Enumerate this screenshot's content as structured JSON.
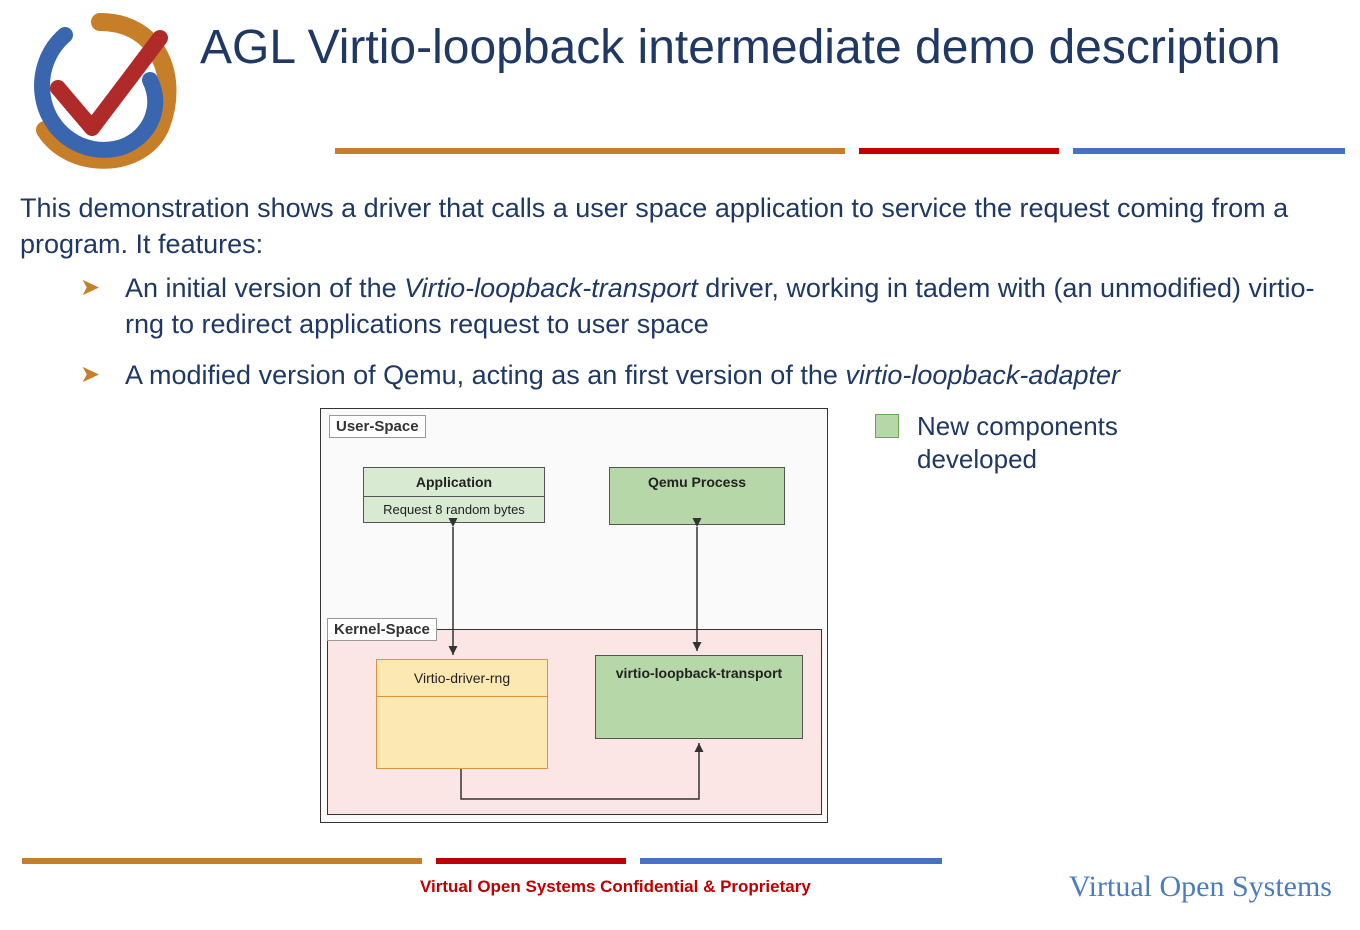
{
  "title": "AGL Virtio-loopback intermediate demo description",
  "intro": "This demonstration shows a driver that calls a user space application to service the request coming from a program. It features:",
  "bullets": {
    "b1_pre": "An initial version of the ",
    "b1_ital": "Virtio-loopback-transport",
    "b1_post": " driver, working in tadem with (an unmodified) virtio-rng to redirect applications request to user space",
    "b2_pre": "A modified version of Qemu, acting as an first version of the ",
    "b2_ital": "virtio-loopback-adapter"
  },
  "legend": "New components developed",
  "diagram": {
    "user_space": "User-Space",
    "kernel_space": "Kernel-Space",
    "application": "Application",
    "application_sub": "Request 8 random bytes",
    "qemu": "Qemu Process",
    "rng": "Virtio-driver-rng",
    "vlt": "virtio-loopback-transport"
  },
  "footer": {
    "confidential": "Virtual Open Systems Confidential & Proprietary",
    "brand": "Virtual Open Systems"
  }
}
